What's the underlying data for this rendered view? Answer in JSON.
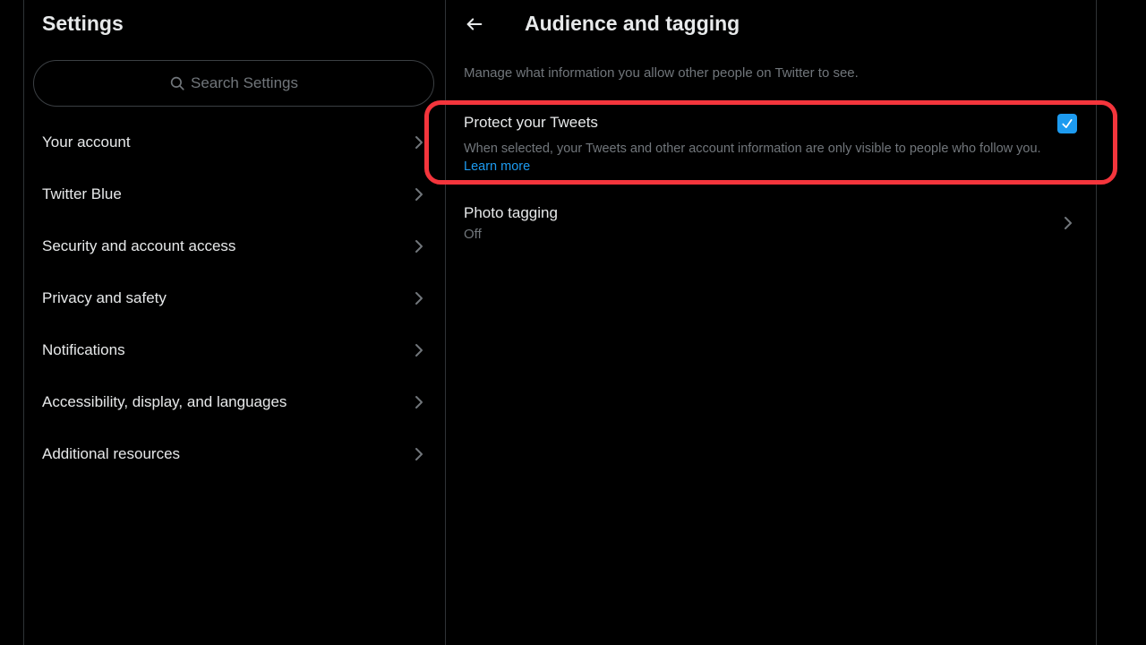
{
  "sidebar": {
    "title": "Settings",
    "search_placeholder": "Search Settings",
    "items": [
      {
        "label": "Your account"
      },
      {
        "label": "Twitter Blue"
      },
      {
        "label": "Security and account access"
      },
      {
        "label": "Privacy and safety"
      },
      {
        "label": "Notifications"
      },
      {
        "label": "Accessibility, display, and languages"
      },
      {
        "label": "Additional resources"
      }
    ]
  },
  "main": {
    "title": "Audience and tagging",
    "description": "Manage what information you allow other people on Twitter to see.",
    "protect_tweets": {
      "title": "Protect your Tweets",
      "description": "When selected, your Tweets and other account information are only visible to people who follow you.",
      "learn_more": "Learn more",
      "checked": true
    },
    "photo_tagging": {
      "title": "Photo tagging",
      "value": "Off"
    }
  },
  "icons": {
    "search": "search-icon",
    "chevron": "chevron-right-icon",
    "back": "arrow-left-icon",
    "check": "checkmark-icon"
  },
  "colors": {
    "background": "#000000",
    "text_primary": "#e7e9ea",
    "text_secondary": "#71767b",
    "accent": "#1d9bf0",
    "divider": "#2f3336",
    "highlight": "#f4353c"
  }
}
